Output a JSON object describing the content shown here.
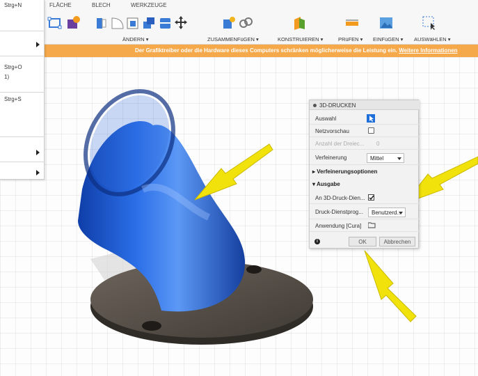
{
  "toolbar": {
    "tabs": [
      "FLÄCHE",
      "BLECH",
      "WERKZEUGE"
    ],
    "groups": [
      "ÄNDERN ▾",
      "ZUSAMMENFüGEN ▾",
      "KONSTRUIEREN ▾",
      "PRüFEN ▾",
      "EINFüGEN ▾",
      "AUSWäHLEN ▾"
    ]
  },
  "banner": {
    "text": "Der Grafiktreiber oder die Hardware dieses Computers schränken möglicherweise die Leistung ein.",
    "link": "Weitere Informationen"
  },
  "menu": {
    "shortcut_new": "Strg+N",
    "shortcut_open": "Strg+O",
    "partial": "1)",
    "shortcut_save": "Strg+S"
  },
  "dialog": {
    "title": "3D-DRUCKEN",
    "selection_label": "Auswahl",
    "mesh_preview_label": "Netzvorschau",
    "triangle_count_label": "Anzahl der Dreiec...",
    "triangle_count_value": "0",
    "refinement_label": "Verfeinerung",
    "refinement_value": "Mittel",
    "refinement_options_label": "Verfeinerungsoptionen",
    "output_section_label": "Ausgabe",
    "send_to_3d_label": "An 3D-Druck-Dien...",
    "print_utility_label": "Druck-Dienstprog...",
    "print_utility_value": "Benutzerd...",
    "application_label": "Anwendung [Cura]",
    "ok_label": "OK",
    "cancel_label": "Abbrechen"
  },
  "colors": {
    "banner": "#f5a94b",
    "part_blue": "#1f5fd6",
    "flange": "#5b544c",
    "arrow": "#f2e20c"
  }
}
